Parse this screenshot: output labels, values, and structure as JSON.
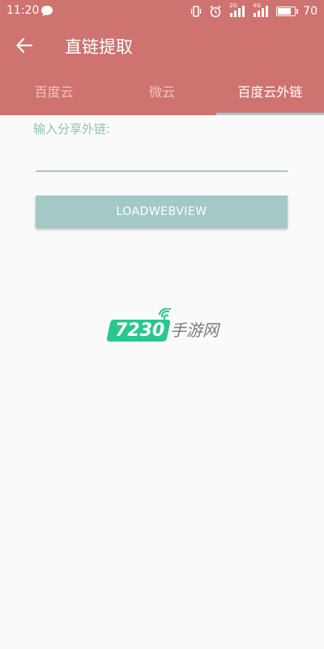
{
  "status_bar": {
    "time": "11:20",
    "signal_1_type": "2G",
    "signal_2_type": "4G",
    "battery_level": "70",
    "icons": [
      "chat-icon",
      "vibrate-icon",
      "alarm-icon",
      "signal-icon",
      "signal-icon",
      "battery-icon"
    ]
  },
  "toolbar": {
    "title": "直链提取",
    "back_icon": "arrow-left-icon"
  },
  "tabs": [
    {
      "label": "百度云",
      "active": false
    },
    {
      "label": "微云",
      "active": false
    },
    {
      "label": "百度云外链",
      "active": true
    }
  ],
  "form": {
    "label": "输入分享外链:",
    "input_value": "",
    "button_label": "LOADWEBVIEW"
  },
  "watermark": {
    "number": "7230",
    "text": "手游网"
  },
  "colors": {
    "header_bg": "#ce7370",
    "accent": "#a3c9c7",
    "label": "#8fc0bc",
    "page_bg": "#fafafa",
    "watermark_green": "#28c78d"
  }
}
